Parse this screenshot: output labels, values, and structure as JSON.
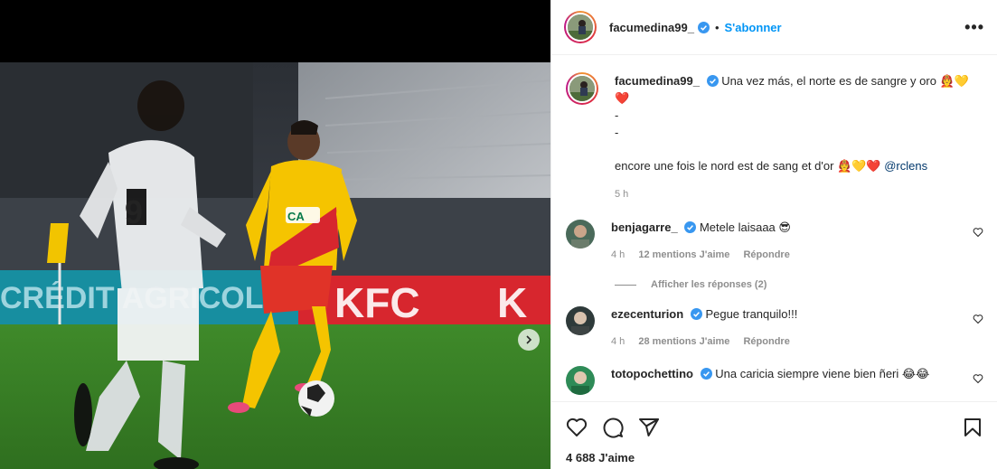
{
  "post": {
    "username": "facumedina99_",
    "dot": "•",
    "follow_label": "S'abonner",
    "more_label": "•••",
    "caption": {
      "username": "facumedina99_",
      "line1": "Una vez más, el norte es de sangre y oro 🧑‍🚒💛",
      "line1_end": "❤️",
      "dash1": "-",
      "dash2": "-",
      "line2": "encore une fois le nord est de sang et d'or 🧑‍🚒💛❤️",
      "mention": "@rclens",
      "time": "5 h"
    },
    "comments": [
      {
        "username": "benjagarre_",
        "text": "Metele laisaaa 😎",
        "time": "4 h",
        "likes": "12 mentions J'aime",
        "reply": "Répondre",
        "avatar_color": "#4a6a5a"
      },
      {
        "username": "ezecenturion",
        "text": "Pegue tranquilo!!!",
        "time": "4 h",
        "likes": "28 mentions J'aime",
        "reply": "Répondre",
        "avatar_color": "#2e3a3a"
      },
      {
        "username": "totopochettino",
        "text": "Una caricia siempre viene bien ñeri 😂😂",
        "avatar_color": "#2e8b57"
      }
    ],
    "view_replies": "Afficher les réponses (2)",
    "likes_count": "4 688 J'aime",
    "icons": {
      "like": "heart-icon",
      "comment": "comment-icon",
      "share": "share-icon",
      "save": "bookmark-icon",
      "next": "chevron-right-icon",
      "verified": "verified-badge-icon"
    },
    "colors": {
      "follow": "#0095f6",
      "verified": "#3897f0",
      "muted": "#8e8e8e",
      "mention": "#00376b"
    }
  }
}
